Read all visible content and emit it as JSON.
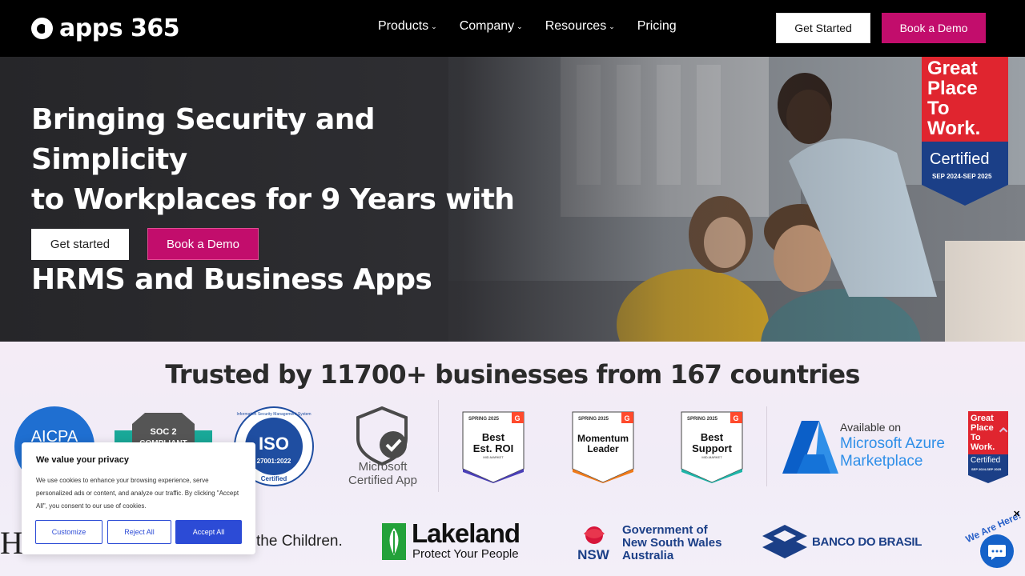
{
  "nav": {
    "logo_text": "apps 365",
    "menu": [
      {
        "label": "Products",
        "has_dropdown": true
      },
      {
        "label": "Company",
        "has_dropdown": true
      },
      {
        "label": "Resources",
        "has_dropdown": true
      },
      {
        "label": "Pricing",
        "has_dropdown": false
      }
    ],
    "get_started": "Get Started",
    "book_demo": "Book a Demo"
  },
  "hero": {
    "title_line1": "Bringing Security and Simplicity",
    "title_line2": "to Workplaces for 9 Years with our",
    "title_line3": "HRMS and Business Apps",
    "get_started": "Get started",
    "book_demo": "Book a Demo",
    "gptw": {
      "line1": "Great",
      "line2": "Place",
      "line3": "To",
      "line4": "Work.",
      "certified": "Certified",
      "period": "SEP 2024-SEP 2025"
    }
  },
  "trusted": {
    "title": "Trusted by 11700+ businesses from 167 countries",
    "aicpa": "AICPA",
    "soc2": "SOC 2",
    "soc2_sub": "COMPLIANT",
    "iso_ring": "Information Security Management System",
    "iso": "ISO",
    "iso_num": "27001:2022",
    "iso_cert": "Certified",
    "microsoft_line1": "Microsoft",
    "microsoft_line2": "Certified App",
    "g2_badges": [
      {
        "season": "SPRING 2025",
        "title": "Best Est. ROI",
        "sub": "MID-MARKET",
        "color": "#4a3fb8"
      },
      {
        "season": "SPRING 2025",
        "title": "Momentum Leader",
        "sub": "",
        "color": "#ef7a1a"
      },
      {
        "season": "SPRING 2025",
        "title": "Best Support",
        "sub": "MID-MARKET",
        "color": "#1fb5a8"
      }
    ],
    "azure_line1": "Available on",
    "azure_line2": "Microsoft Azure",
    "azure_line3": "Marketplace",
    "gptw_small": {
      "line1": "Great",
      "line2": "Place",
      "line3": "To",
      "line4": "Work.",
      "certified": "Certified",
      "period": "SEP 2024-SEP 2025"
    }
  },
  "customers": {
    "save_children": "the Children.",
    "lakeland": "Lakeland",
    "lakeland_tag": "Protect Your People",
    "nsw_short": "NSW",
    "nsw_line1": "Government of",
    "nsw_line2": "New South Wales",
    "nsw_line3": "Australia",
    "banco": "BANCO DO BRASIL",
    "we_are_here": "We Are Here!"
  },
  "cookie": {
    "title": "We value your privacy",
    "text": "We use cookies to enhance your browsing experience, serve personalized ads or content, and analyze our traffic. By clicking \"Accept All\", you consent to our use of cookies.",
    "customize": "Customize",
    "reject": "Reject All",
    "accept": "Accept All"
  },
  "colors": {
    "brand_pink": "#c20d6c",
    "nav_bg": "#000000",
    "cookie_blue": "#2c4bd6"
  }
}
